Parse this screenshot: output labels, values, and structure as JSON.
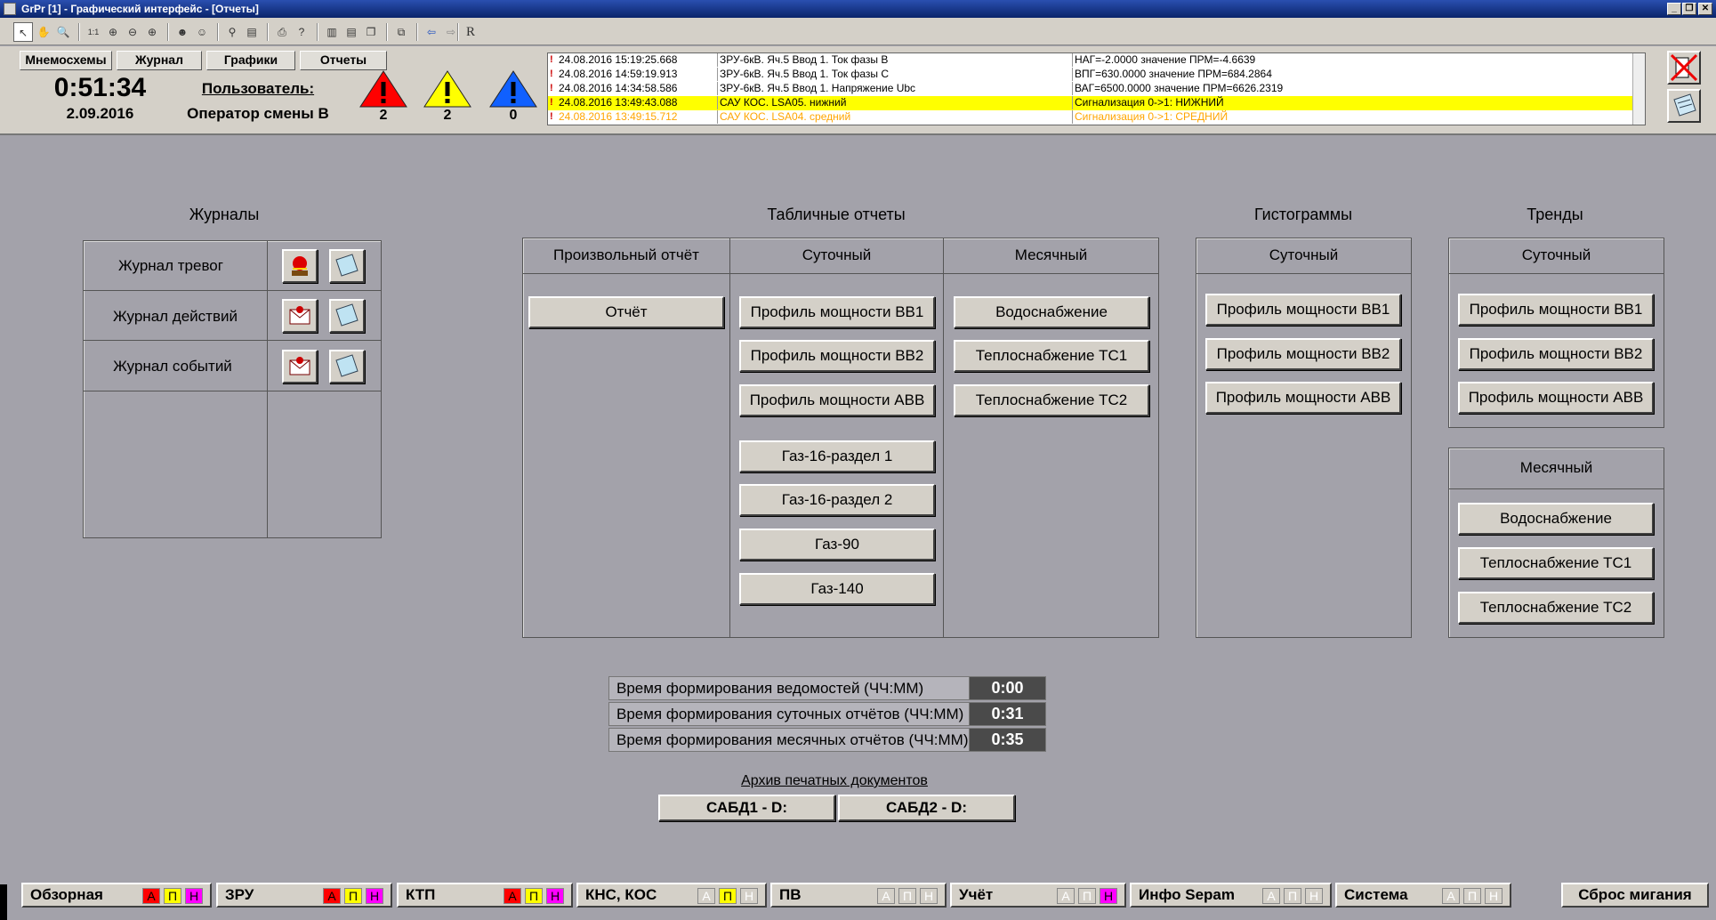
{
  "window": {
    "title": "GrPr [1] - Графический интерфейс - [Отчеты]",
    "min": "_",
    "restore": "❐",
    "close": "✕"
  },
  "toolbar": {
    "r_label": "R"
  },
  "nav": {
    "tabs": [
      "Мнемосхемы",
      "Журнал",
      "Графики",
      "Отчеты"
    ]
  },
  "clock": {
    "time": "0:51:34",
    "date": "2.09.2016"
  },
  "user": {
    "label": "Пользователь:",
    "name": "Оператор смены  В"
  },
  "alarms": [
    {
      "name": "red",
      "color": "#ff0000",
      "count": "2"
    },
    {
      "name": "yellow",
      "color": "#ffff00",
      "count": "2"
    },
    {
      "name": "blue",
      "color": "#1060ff",
      "count": "0"
    }
  ],
  "events": [
    {
      "flag": "!",
      "datetime": "24.08.2016 15:19:25.668",
      "tag": "ЗРУ-6кВ. Яч.5 Ввод 1. Ток фазы В",
      "value": "НАГ=-2.0000  значение ПРМ=-4.6639",
      "bg": "#ffffff",
      "fg": "#000000"
    },
    {
      "flag": "!",
      "datetime": "24.08.2016 14:59:19.913",
      "tag": "ЗРУ-6кВ. Яч.5 Ввод 1. Ток фазы С",
      "value": "ВПГ=630.0000  значение ПРМ=684.2864",
      "bg": "#ffffff",
      "fg": "#000000"
    },
    {
      "flag": "!",
      "datetime": "24.08.2016 14:34:58.586",
      "tag": "ЗРУ-6кВ. Яч.5 Ввод 1. Напряжение Ubc",
      "value": "ВАГ=6500.0000  значение ПРМ=6626.2319",
      "bg": "#ffffff",
      "fg": "#000000"
    },
    {
      "flag": "!",
      "datetime": "24.08.2016 13:49:43.088",
      "tag": "САУ КОС. LSA05. нижний",
      "value": "Сигнализация  0->1:    НИЖНИЙ",
      "bg": "#ffff00",
      "fg": "#000000"
    },
    {
      "flag": "!",
      "datetime": "24.08.2016 13:49:15.712",
      "tag": "САУ КОС. LSA04. средний",
      "value": "Сигнализация  0->1:    СРЕДНИЙ",
      "bg": "#ffffff",
      "fg": "#ffa500"
    }
  ],
  "journals": {
    "title": "Журналы",
    "rows": [
      "Журнал тревог",
      "Журнал действий",
      "Журнал событий"
    ]
  },
  "tables": {
    "title": "Табличные отчеты",
    "arbitrary": {
      "header": "Произвольный отчёт",
      "buttons": [
        "Отчёт"
      ]
    },
    "daily": {
      "header": "Суточный",
      "buttons": [
        "Профиль мощности ВВ1",
        "Профиль мощности ВВ2",
        "Профиль мощности АВВ",
        "Газ-16-раздел 1",
        "Газ-16-раздел 2",
        "Газ-90",
        "Газ-140"
      ]
    },
    "monthly": {
      "header": "Месячный",
      "buttons": [
        "Водоснабжение",
        "Теплоснабжение ТС1",
        "Теплоснабжение ТС2"
      ]
    }
  },
  "histograms": {
    "title": "Гистограммы",
    "header": "Суточный",
    "buttons": [
      "Профиль мощности ВВ1",
      "Профиль мощности ВВ2",
      "Профиль мощности АВВ"
    ]
  },
  "trends": {
    "title": "Тренды",
    "daily_header": "Суточный",
    "daily_buttons": [
      "Профиль мощности ВВ1",
      "Профиль мощности ВВ2",
      "Профиль мощности АВВ"
    ],
    "monthly_header": "Месячный",
    "monthly_buttons": [
      "Водоснабжение",
      "Теплоснабжение ТС1",
      "Теплоснабжение ТС2"
    ]
  },
  "timings": [
    {
      "label": "Время формирования ведомостей (ЧЧ:ММ)",
      "value": "0:00"
    },
    {
      "label": "Время формирования суточных отчётов (ЧЧ:ММ)",
      "value": "0:31"
    },
    {
      "label": "Время формирования месячных отчётов (ЧЧ:ММ)",
      "value": "0:35"
    }
  ],
  "archive": {
    "title": "Архив печатных документов",
    "buttons": [
      "САБД1 - D:",
      "САБД2 - D:"
    ]
  },
  "bottom": {
    "groups": [
      {
        "name": "Обзорная",
        "a": "А",
        "p": "П",
        "n": "Н",
        "a_color": "#ff0000",
        "p_color": "#ffff00",
        "n_color": "#ff00ff"
      },
      {
        "name": "ЗРУ",
        "a": "А",
        "p": "П",
        "n": "Н",
        "a_color": "#ff0000",
        "p_color": "#ffff00",
        "n_color": "#ff00ff"
      },
      {
        "name": "КТП",
        "a": "А",
        "p": "П",
        "n": "Н",
        "a_color": "#ff0000",
        "p_color": "#ffff00",
        "n_color": "#ff00ff"
      },
      {
        "name": "КНС, КОС",
        "a": "А",
        "p": "П",
        "n": "Н",
        "a_color": "#d4d0c8",
        "p_color": "#ffff00",
        "n_color": "#d4d0c8"
      },
      {
        "name": "ПВ",
        "a": "А",
        "p": "П",
        "n": "Н",
        "a_color": "#d4d0c8",
        "p_color": "#d4d0c8",
        "n_color": "#d4d0c8"
      },
      {
        "name": "Учёт",
        "a": "А",
        "p": "П",
        "n": "Н",
        "a_color": "#d4d0c8",
        "p_color": "#d4d0c8",
        "n_color": "#ff00ff"
      },
      {
        "name": "Инфо Sepam",
        "a": "А",
        "p": "П",
        "n": "Н",
        "a_color": "#d4d0c8",
        "p_color": "#d4d0c8",
        "n_color": "#d4d0c8"
      },
      {
        "name": "Система",
        "a": "А",
        "p": "П",
        "n": "Н",
        "a_color": "#d4d0c8",
        "p_color": "#d4d0c8",
        "n_color": "#d4d0c8"
      }
    ],
    "reset": "Сброс мигания"
  }
}
